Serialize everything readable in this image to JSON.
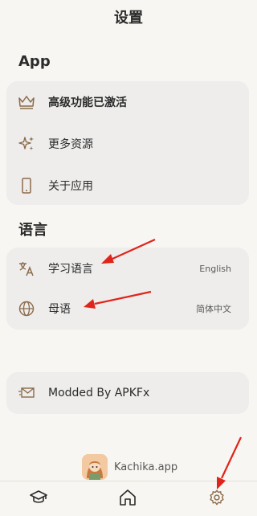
{
  "header": {
    "title": "设置"
  },
  "sections": {
    "app": {
      "title": "App",
      "items": [
        {
          "label": "高级功能已激活",
          "icon": "crown-icon"
        },
        {
          "label": "更多资源",
          "icon": "sparkle-icon"
        },
        {
          "label": "关于应用",
          "icon": "phone-icon"
        }
      ]
    },
    "language": {
      "title": "语言",
      "items": [
        {
          "label": "学习语言",
          "value": "English",
          "icon": "translate-icon"
        },
        {
          "label": "母语",
          "value": "简体中文",
          "icon": "globe-icon"
        }
      ]
    },
    "extra": {
      "items": [
        {
          "label": "Modded By APKFx",
          "icon": "mail-icon"
        }
      ]
    }
  },
  "brand": {
    "name": "Kachika.app"
  },
  "nav": {
    "items": [
      {
        "icon": "graduation-cap-icon"
      },
      {
        "icon": "home-icon"
      },
      {
        "icon": "gear-icon"
      }
    ]
  },
  "colors": {
    "accent_icon": "#8b6b4a",
    "card_bg": "#eeedec",
    "page_bg": "#f8f6f2",
    "annotation_arrow": "#e0241b"
  }
}
